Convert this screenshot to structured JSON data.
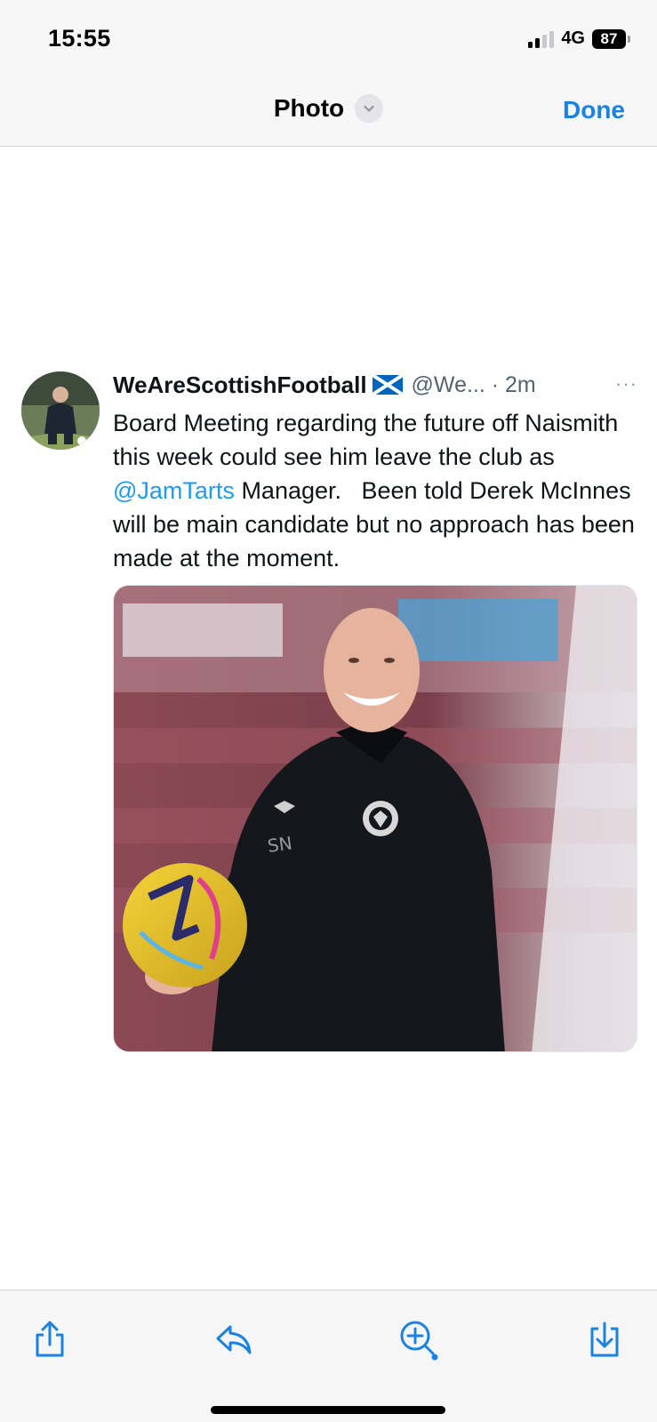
{
  "status_bar": {
    "time": "15:55",
    "network": "4G",
    "battery": "87"
  },
  "nav": {
    "title": "Photo",
    "done_label": "Done"
  },
  "tweet": {
    "author": "WeAreScottishFootball",
    "handle_time": "@We... · 2m",
    "more": "···",
    "text_before": "Board Meeting regarding the future off Naismith this week could see him leave the club as ",
    "mention": "@JamTarts",
    "text_after": " Manager.   Been told Derek McInnes will be main candidate but no approach has been made at the moment."
  },
  "toolbar": {
    "icons": [
      "share-icon",
      "reply-icon",
      "zoom-in-icon",
      "download-icon"
    ]
  },
  "colors": {
    "accent": "#1a82e2",
    "mention": "#1d9bf0",
    "flag_blue": "#0065bd"
  }
}
